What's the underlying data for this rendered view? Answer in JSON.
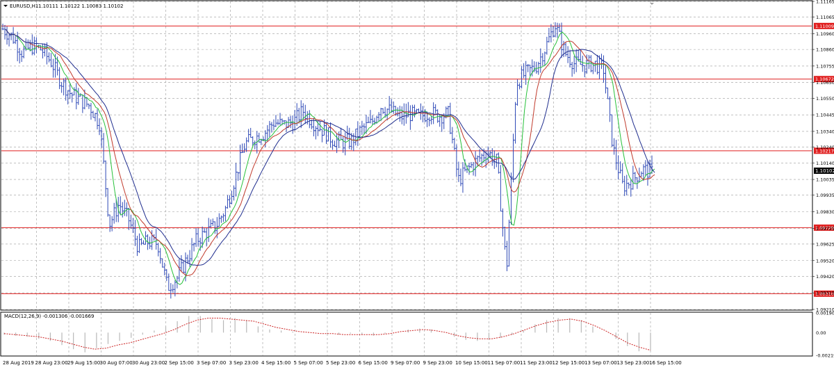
{
  "main_panel": {
    "symbol_label": "EURUSD,H1",
    "ohlc_label": "1.10111 1.10122 1.10083 1.10102",
    "current_price": "1.10102"
  },
  "macd_panel": {
    "label": "MACD(12,26,9) -0.001306 -0.001669",
    "y_ticks": [
      "0.00190",
      "0.00",
      "-0.00219"
    ]
  },
  "colors": {
    "price_bars": "#2d48b6",
    "fast_ma": "#27c13a",
    "medium_ma": "#c0392b",
    "slow_ma": "#1f2d8e",
    "level_lines": "#e01f1f",
    "level_label_bg": "#e01f1f",
    "current_price_bg": "#000000",
    "grid": "#9a9a9a",
    "macd_histogram": "#b8b8b8",
    "macd_signal": "#cc2222"
  },
  "chart_data": [
    {
      "type": "line",
      "title": "EURUSD,H1",
      "subtitle": "1.10111 1.10122 1.10083 1.10102",
      "x_tick_labels": [
        "28 Aug 2019",
        "28 Aug 23:00",
        "29 Aug 15:00",
        "30 Aug 07:00",
        "30 Aug 23:00",
        "2 Sep 15:00",
        "3 Sep 07:00",
        "3 Sep 23:00",
        "4 Sep 15:00",
        "5 Sep 07:00",
        "5 Sep 23:00",
        "6 Sep 15:00",
        "9 Sep 07:00",
        "9 Sep 23:00",
        "10 Sep 15:00",
        "11 Sep 07:00",
        "11 Sep 23:00",
        "12 Sep 15:00",
        "13 Sep 07:00",
        "13 Sep 23:00",
        "16 Sep 15:00"
      ],
      "y_tick_labels": [
        "1.11165",
        "1.11065",
        "1.10960",
        "1.10860",
        "1.10755",
        "1.10650",
        "1.10550",
        "1.10445",
        "1.10340",
        "1.10240",
        "1.10140",
        "1.10035",
        "1.09935",
        "1.09830",
        "1.09725",
        "1.09625",
        "1.09520",
        "1.09420",
        "1.09315",
        "1.09210"
      ],
      "ylim": [
        1.0921,
        1.11165
      ],
      "grid": true,
      "levels": [
        "1.11009",
        "1.10672",
        "1.10217",
        "1.09729",
        "1.09310"
      ],
      "series": [
        {
          "values": [
            1.1099,
            1.1094,
            1.1084,
            1.1088,
            1.1086,
            1.1078,
            1.1066,
            1.1058,
            1.1054,
            1.105,
            1.1039,
            1.0975,
            1.0988,
            1.0978,
            1.096,
            1.0964,
            1.0963,
            1.0935,
            1.0941,
            1.0953,
            1.0965,
            1.097,
            1.0974,
            1.0985,
            1.1005,
            1.1026,
            1.103,
            1.1033,
            1.104,
            1.1038,
            1.104,
            1.1047,
            1.104,
            1.1035,
            1.1029,
            1.1027,
            1.1028,
            1.1035,
            1.1039,
            1.105,
            1.1047,
            1.1043,
            1.1045,
            1.1043,
            1.1046,
            1.1044,
            1.1045,
            1.1003,
            1.101,
            1.1016,
            1.1021,
            1.1015,
            1.0946,
            1.1065,
            1.1071,
            1.1075,
            1.1087,
            1.1102,
            1.1084,
            1.1077,
            1.1076,
            1.1077,
            1.1074,
            1.1023,
            1.0999,
            1.1003,
            1.101,
            1.1008
          ]
        }
      ]
    },
    {
      "type": "bar",
      "title": "MACD(12,26,9) -0.001306 -0.001669",
      "ylim": [
        -0.00219,
        0.0019
      ],
      "series": [
        {
          "values": [
            -0.0002,
            -0.0003,
            -0.0004,
            -0.0006,
            -0.0008,
            -0.0012,
            -0.0016,
            -0.0019,
            -0.0015,
            -0.0011,
            -0.0008,
            -0.0005,
            -0.0002,
            0.0002,
            0.0006,
            0.0011,
            0.0016,
            0.0016,
            0.0013,
            0.0012,
            0.0014,
            0.0012,
            0.0006,
            0.0003,
            0.0002,
            0.0001,
            0.0,
            0.0,
            -0.0001,
            -0.0002,
            -0.0001,
            -0.0002,
            -0.0003,
            -0.0001,
            0.0,
            0.0003,
            0.0004,
            0.0003,
            0.0,
            -0.0004,
            -0.0007,
            -0.0008,
            -0.0007,
            -0.0005,
            -0.0002,
            0.0002,
            0.0008,
            0.0012,
            0.0014,
            0.0014,
            0.0012,
            0.0006,
            0.0,
            -0.0006,
            -0.0013,
            -0.0018,
            -0.0017
          ]
        },
        {
          "values": [
            -0.0001,
            -0.0002,
            -0.0003,
            -0.0004,
            -0.0006,
            -0.0008,
            -0.0011,
            -0.0014,
            -0.0016,
            -0.0015,
            -0.0012,
            -0.001,
            -0.0007,
            -0.0004,
            -0.0001,
            0.0003,
            0.0008,
            0.0012,
            0.0014,
            0.0014,
            0.0013,
            0.0012,
            0.0011,
            0.0008,
            0.0005,
            0.0003,
            0.0001,
            0.0,
            -0.0001,
            -0.0001,
            -0.0002,
            -0.0002,
            -0.0002,
            -0.0002,
            -0.0001,
            0.0001,
            0.0002,
            0.0003,
            0.0002,
            0.0,
            -0.0003,
            -0.0005,
            -0.0006,
            -0.0006,
            -0.0004,
            -0.0001,
            0.0003,
            0.0007,
            0.001,
            0.0012,
            0.0013,
            0.0011,
            0.0007,
            0.0002,
            -0.0004,
            -0.001,
            -0.0014,
            -0.0017
          ]
        }
      ]
    }
  ]
}
